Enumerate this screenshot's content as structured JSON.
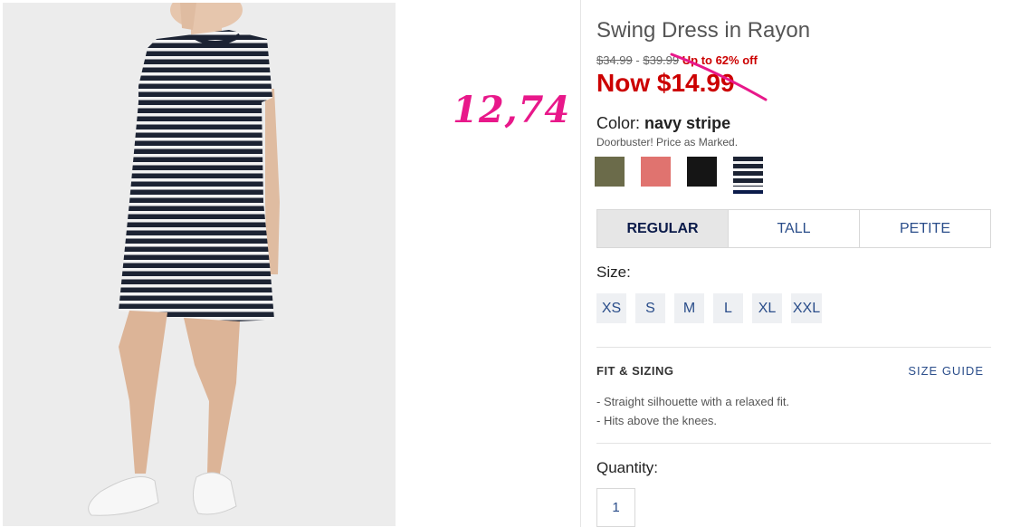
{
  "annotation": "12,74",
  "product": {
    "title": "Swing Dress in Rayon",
    "price_low": "$34.99",
    "price_sep": "-",
    "price_high": "$39.99",
    "discount": "Up to 62% off",
    "now_price": "Now $14.99",
    "color_label": "Color:",
    "color_value": "navy stripe",
    "promo_note": "Doorbuster! Price as Marked."
  },
  "swatches": [
    {
      "name": "olive",
      "color": "#6b6b4a"
    },
    {
      "name": "coral",
      "color": "#e0736f"
    },
    {
      "name": "black",
      "color": "#151515"
    },
    {
      "name": "navy stripe",
      "color": "#0b1b4a",
      "selected": true
    }
  ],
  "fit_options": [
    "REGULAR",
    "TALL",
    "PETITE"
  ],
  "size_label": "Size:",
  "sizes": [
    "XS",
    "S",
    "M",
    "L",
    "XL",
    "XXL"
  ],
  "fit_sizing": {
    "heading": "FIT & SIZING",
    "guide_link": "SIZE GUIDE",
    "bullets": [
      "- Straight silhouette with a relaxed fit.",
      "- Hits above the knees."
    ]
  },
  "quantity": {
    "label": "Quantity:",
    "value": "1"
  },
  "colors": {
    "sale_red": "#cc0000",
    "link_blue": "#2a4d8a",
    "annotation_pink": "#e8188a"
  }
}
